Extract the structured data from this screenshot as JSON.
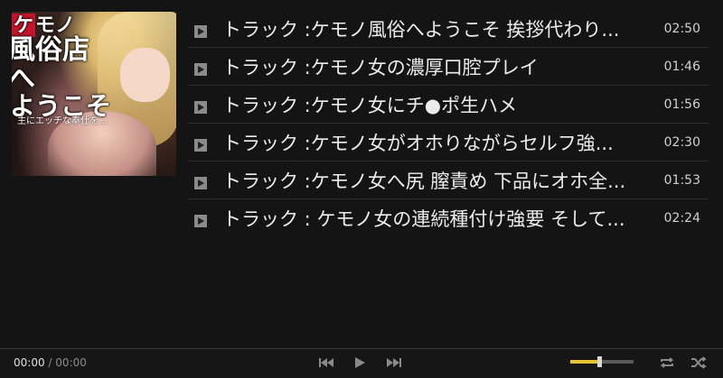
{
  "album": {
    "cover_line1_red": "ケ",
    "cover_line1": "モノ",
    "cover_line2": "風俗店へ",
    "cover_line3": "ようこそ",
    "cover_sub": "主にエッチな奉仕を…"
  },
  "tracks": [
    {
      "title": "トラック :ケモノ風俗へようこそ 挨拶代わり...",
      "duration": "02:50"
    },
    {
      "title": "トラック :ケモノ女の濃厚口腔プレイ",
      "duration": "01:46"
    },
    {
      "title": "トラック :ケモノ女にチ●ポ生ハメ",
      "duration": "01:56"
    },
    {
      "title": "トラック :ケモノ女がオホりながらセルフ強...",
      "duration": "02:30"
    },
    {
      "title": "トラック :ケモノ女へ尻 膣責め 下品にオホ全...",
      "duration": "01:53"
    },
    {
      "title": "トラック : ケモノ女の連続種付け強要 そして...",
      "duration": "02:24"
    }
  ],
  "player": {
    "current_time": "00:00",
    "separator": "/",
    "total_time": "00:00",
    "volume_level": 0.46,
    "icons": {
      "prev": "skip-previous-icon",
      "play": "play-icon",
      "next": "skip-next-icon",
      "repeat": "repeat-icon",
      "shuffle": "shuffle-icon",
      "track_play": "play-square-icon"
    }
  }
}
